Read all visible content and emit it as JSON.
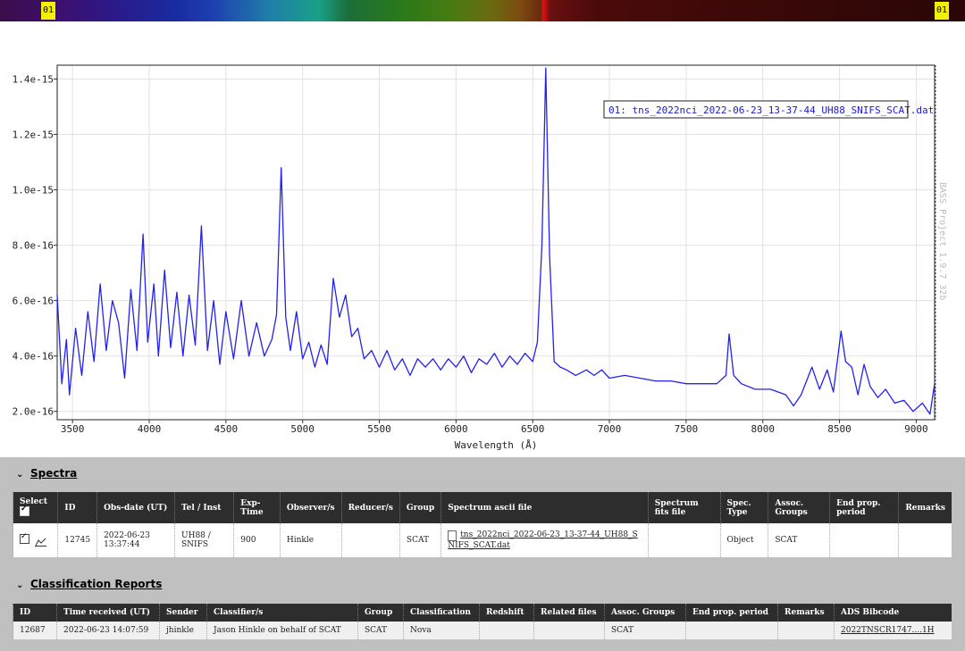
{
  "strip": {
    "left_tag": "01",
    "right_tag": "01"
  },
  "chart_data": {
    "type": "line",
    "xlabel": "Wavelength (Å)",
    "ylabel": "",
    "xlim": [
      3400,
      9120
    ],
    "ylim": [
      1.7e-16,
      1.45e-15
    ],
    "x_ticks": [
      "3500",
      "4000",
      "4500",
      "5000",
      "5500",
      "6000",
      "6500",
      "7000",
      "7500",
      "8000",
      "8500",
      "9000"
    ],
    "y_ticks": [
      "2.0e-16",
      "4.0e-16",
      "6.0e-16",
      "8.0e-16",
      "1.0e-15",
      "1.2e-15",
      "1.4e-15"
    ],
    "grid": true,
    "legend": "top-right",
    "watermark": "BASS Project 1.9.7 32b",
    "series": [
      {
        "name": "01: tns_2022nci_2022-06-23_13-37-44_UH88_SNIFS_SCAT.dat",
        "color": "#2222ee",
        "points": [
          [
            3400,
            6.2e-16
          ],
          [
            3430,
            3e-16
          ],
          [
            3460,
            4.6e-16
          ],
          [
            3480,
            2.6e-16
          ],
          [
            3520,
            5e-16
          ],
          [
            3560,
            3.3e-16
          ],
          [
            3600,
            5.6e-16
          ],
          [
            3640,
            3.8e-16
          ],
          [
            3680,
            6.6e-16
          ],
          [
            3720,
            4.2e-16
          ],
          [
            3760,
            6e-16
          ],
          [
            3800,
            5.2e-16
          ],
          [
            3840,
            3.2e-16
          ],
          [
            3880,
            6.4e-16
          ],
          [
            3920,
            4.2e-16
          ],
          [
            3960,
            8.4e-16
          ],
          [
            3990,
            4.5e-16
          ],
          [
            4030,
            6.6e-16
          ],
          [
            4060,
            4e-16
          ],
          [
            4100,
            7.1e-16
          ],
          [
            4140,
            4.3e-16
          ],
          [
            4180,
            6.3e-16
          ],
          [
            4220,
            4e-16
          ],
          [
            4260,
            6.2e-16
          ],
          [
            4300,
            4.4e-16
          ],
          [
            4340,
            8.7e-16
          ],
          [
            4380,
            4.2e-16
          ],
          [
            4420,
            6e-16
          ],
          [
            4460,
            3.7e-16
          ],
          [
            4500,
            5.6e-16
          ],
          [
            4550,
            3.9e-16
          ],
          [
            4600,
            6e-16
          ],
          [
            4650,
            4e-16
          ],
          [
            4700,
            5.2e-16
          ],
          [
            4750,
            4e-16
          ],
          [
            4800,
            4.6e-16
          ],
          [
            4830,
            5.5e-16
          ],
          [
            4860,
            1.08e-15
          ],
          [
            4890,
            5.4e-16
          ],
          [
            4920,
            4.2e-16
          ],
          [
            4960,
            5.6e-16
          ],
          [
            5000,
            3.9e-16
          ],
          [
            5040,
            4.5e-16
          ],
          [
            5080,
            3.6e-16
          ],
          [
            5120,
            4.4e-16
          ],
          [
            5160,
            3.7e-16
          ],
          [
            5200,
            6.8e-16
          ],
          [
            5240,
            5.4e-16
          ],
          [
            5280,
            6.2e-16
          ],
          [
            5320,
            4.7e-16
          ],
          [
            5360,
            5e-16
          ],
          [
            5400,
            3.9e-16
          ],
          [
            5450,
            4.2e-16
          ],
          [
            5500,
            3.6e-16
          ],
          [
            5550,
            4.2e-16
          ],
          [
            5600,
            3.5e-16
          ],
          [
            5650,
            3.9e-16
          ],
          [
            5700,
            3.3e-16
          ],
          [
            5750,
            3.9e-16
          ],
          [
            5800,
            3.6e-16
          ],
          [
            5850,
            3.9e-16
          ],
          [
            5900,
            3.5e-16
          ],
          [
            5950,
            3.9e-16
          ],
          [
            6000,
            3.6e-16
          ],
          [
            6050,
            4e-16
          ],
          [
            6100,
            3.4e-16
          ],
          [
            6150,
            3.9e-16
          ],
          [
            6200,
            3.7e-16
          ],
          [
            6250,
            4.1e-16
          ],
          [
            6300,
            3.6e-16
          ],
          [
            6350,
            4e-16
          ],
          [
            6400,
            3.7e-16
          ],
          [
            6450,
            4.1e-16
          ],
          [
            6500,
            3.8e-16
          ],
          [
            6530,
            4.5e-16
          ],
          [
            6560,
            8e-16
          ],
          [
            6585,
            1.44e-15
          ],
          [
            6610,
            7.6e-16
          ],
          [
            6640,
            3.8e-16
          ],
          [
            6680,
            3.6e-16
          ],
          [
            6720,
            3.5e-16
          ],
          [
            6780,
            3.3e-16
          ],
          [
            6850,
            3.5e-16
          ],
          [
            6900,
            3.3e-16
          ],
          [
            6950,
            3.5e-16
          ],
          [
            7000,
            3.2e-16
          ],
          [
            7100,
            3.3e-16
          ],
          [
            7200,
            3.2e-16
          ],
          [
            7300,
            3.1e-16
          ],
          [
            7400,
            3.1e-16
          ],
          [
            7500,
            3e-16
          ],
          [
            7600,
            3e-16
          ],
          [
            7700,
            3e-16
          ],
          [
            7760,
            3.3e-16
          ],
          [
            7780,
            4.8e-16
          ],
          [
            7810,
            3.3e-16
          ],
          [
            7860,
            3e-16
          ],
          [
            7950,
            2.8e-16
          ],
          [
            8050,
            2.8e-16
          ],
          [
            8150,
            2.6e-16
          ],
          [
            8200,
            2.2e-16
          ],
          [
            8250,
            2.6e-16
          ],
          [
            8320,
            3.6e-16
          ],
          [
            8370,
            2.8e-16
          ],
          [
            8420,
            3.5e-16
          ],
          [
            8460,
            2.7e-16
          ],
          [
            8510,
            4.9e-16
          ],
          [
            8540,
            3.8e-16
          ],
          [
            8580,
            3.6e-16
          ],
          [
            8620,
            2.6e-16
          ],
          [
            8660,
            3.7e-16
          ],
          [
            8700,
            2.9e-16
          ],
          [
            8750,
            2.5e-16
          ],
          [
            8800,
            2.8e-16
          ],
          [
            8860,
            2.3e-16
          ],
          [
            8920,
            2.4e-16
          ],
          [
            8980,
            2e-16
          ],
          [
            9040,
            2.3e-16
          ],
          [
            9090,
            1.9e-16
          ],
          [
            9120,
            3e-16
          ]
        ]
      }
    ]
  },
  "spectra": {
    "title": "Spectra",
    "headers": [
      "Select",
      "ID",
      "Obs-date (UT)",
      "Tel / Inst",
      "Exp-Time",
      "Observer/s",
      "Reducer/s",
      "Group",
      "Spectrum ascii file",
      "Spectrum fits file",
      "Spec. Type",
      "Assoc. Groups",
      "End prop. period",
      "Remarks"
    ],
    "row": {
      "id": "12745",
      "obs_date": "2022-06-23 13:37:44",
      "tel_inst": "UH88 / SNIFS",
      "exp_time": "900",
      "observer": "Hinkle",
      "reducer": "",
      "group": "SCAT",
      "ascii_file": "tns_2022nci_2022-06-23_13-37-44_UH88_SNIFS_SCAT.dat",
      "fits_file": "",
      "spec_type": "Object",
      "assoc_groups": "SCAT",
      "end_prop": "",
      "remarks": ""
    }
  },
  "classification": {
    "title": "Classification Reports",
    "headers": [
      "ID",
      "Time received (UT)",
      "Sender",
      "Classifier/s",
      "Group",
      "Classification",
      "Redshift",
      "Related files",
      "Assoc. Groups",
      "End prop. period",
      "Remarks",
      "ADS Bibcode"
    ],
    "row": {
      "id": "12687",
      "time_received": "2022-06-23 14:07:59",
      "sender": "jhinkle",
      "classifier": "Jason Hinkle on behalf of SCAT",
      "group": "SCAT",
      "classification": "Nova",
      "redshift": "",
      "related_files": "",
      "assoc_groups": "SCAT",
      "end_prop": "",
      "remarks": "",
      "bibcode": "2022TNSCR1747....1H"
    }
  }
}
